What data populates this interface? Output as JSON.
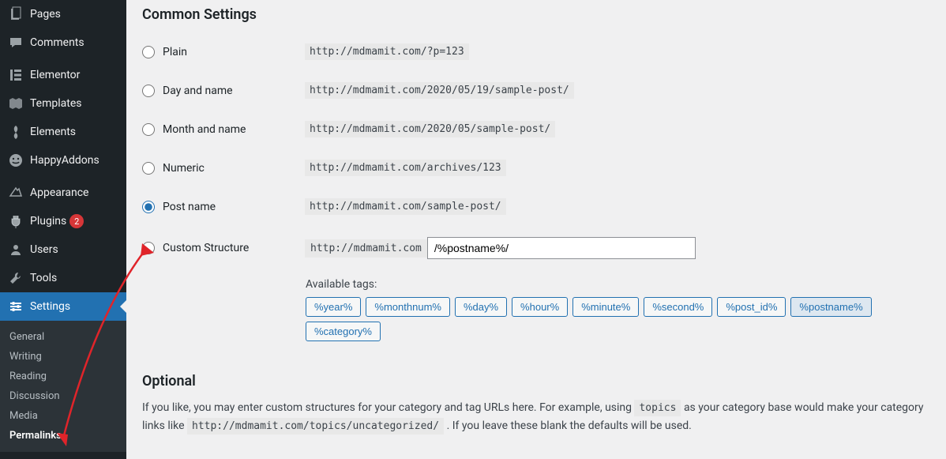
{
  "sidebar": {
    "items": [
      {
        "label": "Pages",
        "icon": "pages"
      },
      {
        "label": "Comments",
        "icon": "comments"
      },
      {
        "sep": true
      },
      {
        "label": "Elementor",
        "icon": "elementor"
      },
      {
        "label": "Templates",
        "icon": "templates"
      },
      {
        "label": "Elements",
        "icon": "elements"
      },
      {
        "label": "HappyAddons",
        "icon": "happy"
      },
      {
        "sep": true
      },
      {
        "label": "Appearance",
        "icon": "appearance"
      },
      {
        "label": "Plugins",
        "icon": "plugins",
        "badge": "2"
      },
      {
        "label": "Users",
        "icon": "users"
      },
      {
        "label": "Tools",
        "icon": "tools"
      },
      {
        "label": "Settings",
        "icon": "settings",
        "active": true
      }
    ],
    "submenu": [
      {
        "label": "General"
      },
      {
        "label": "Writing"
      },
      {
        "label": "Reading"
      },
      {
        "label": "Discussion"
      },
      {
        "label": "Media"
      },
      {
        "label": "Permalinks",
        "current": true
      }
    ]
  },
  "main": {
    "heading_common": "Common Settings",
    "options": [
      {
        "label": "Plain",
        "example": "http://mdmamit.com/?p=123"
      },
      {
        "label": "Day and name",
        "example": "http://mdmamit.com/2020/05/19/sample-post/"
      },
      {
        "label": "Month and name",
        "example": "http://mdmamit.com/2020/05/sample-post/"
      },
      {
        "label": "Numeric",
        "example": "http://mdmamit.com/archives/123"
      },
      {
        "label": "Post name",
        "example": "http://mdmamit.com/sample-post/",
        "checked": true
      },
      {
        "label": "Custom Structure",
        "prefix": "http://mdmamit.com",
        "input": "/%postname%/"
      }
    ],
    "available_tags_label": "Available tags:",
    "tags": [
      "%year%",
      "%monthnum%",
      "%day%",
      "%hour%",
      "%minute%",
      "%second%",
      "%post_id%",
      "%postname%",
      "%category%"
    ],
    "active_tag": "%postname%",
    "heading_optional": "Optional",
    "optional_text_1": "If you like, you may enter custom structures for your category and tag URLs here. For example, using ",
    "optional_code_1": "topics",
    "optional_text_2": " as your category base would make your category links like ",
    "optional_code_2": "http://mdmamit.com/topics/uncategorized/",
    "optional_text_3": " . If you leave these blank the defaults will be used."
  }
}
